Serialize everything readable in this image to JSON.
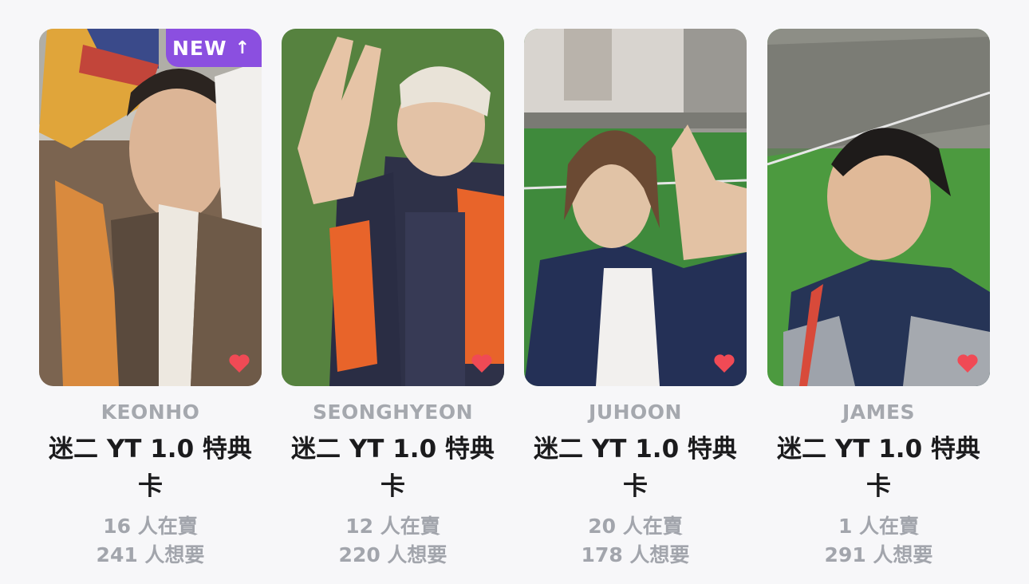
{
  "cards": [
    {
      "member": "KEONHO",
      "title": "迷二 YT 1.0 特典卡",
      "selling": "16 人在賣",
      "wanting": "241 人想要",
      "badge": "NEW",
      "badge_arrow": "↑",
      "favorited": true
    },
    {
      "member": "SEONGHYEON",
      "title": "迷二 YT 1.0 特典卡",
      "selling": "12 人在賣",
      "wanting": "220 人想要",
      "favorited": true
    },
    {
      "member": "JUHOON",
      "title": "迷二 YT 1.0 特典卡",
      "selling": "20 人在賣",
      "wanting": "178 人想要",
      "favorited": true
    },
    {
      "member": "JAMES",
      "title": "迷二 YT 1.0 特典卡",
      "selling": "1 人在賣",
      "wanting": "291 人想要",
      "favorited": true
    }
  ],
  "colors": {
    "badge": "#8b4fe0",
    "heart": "#f04a55",
    "member_text": "#a5a8ae",
    "title_text": "#1b1b1d",
    "stats_text": "#a2a5ac"
  },
  "icons": {
    "favorite": "heart-icon",
    "badge_arrow": "arrow-up-icon"
  }
}
